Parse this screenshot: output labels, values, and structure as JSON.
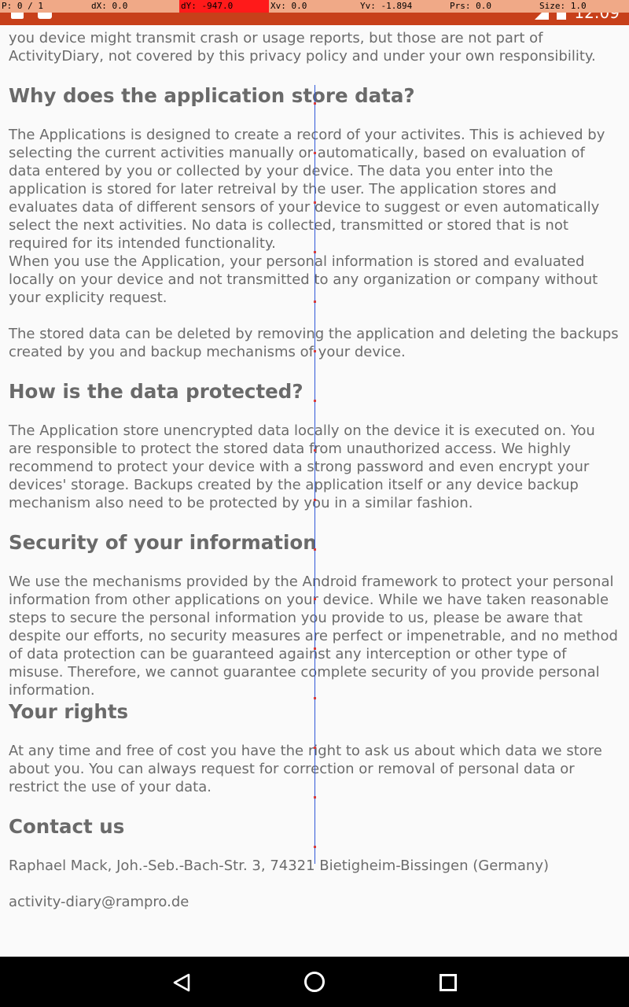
{
  "pointer_overlay": {
    "p": "P: 0 / 1",
    "dx": "dX: 0.0",
    "dy": "dY: -947.0",
    "xv": "Xv: 0.0",
    "yv": "Yv: -1.894",
    "prs": "Prs: 0.0",
    "size": "Size: 1.0"
  },
  "status_bar": {
    "time": "12:09"
  },
  "document": {
    "intro_tail": "you device might transmit crash or usage reports, but those are not part of ActivityDiary, not covered by this privacy policy and under your own responsibility.",
    "sections": [
      {
        "heading": "Why does the application store data?",
        "paragraphs": [
          "The Applications is designed to create a record of your activites. This is achieved by selecting the current activities manually or automatically, based on evaluation of data entered by you or collected by your device. The data you enter into the application is stored for later retreival by the user. The application stores and evaluates data of different sensors of your device to suggest or even automatically select the next activities. No data is collected, transmitted or stored that is not required for its intended functionality.",
          "When you use the Application, your personal information is stored and evaluated locally on your device and not transmitted to any organization or company without your explicity request.",
          "The stored data can be deleted by removing the application and deleting the backups created by you and backup mechanisms of your device."
        ]
      },
      {
        "heading": "How is the data protected?",
        "paragraphs": [
          "The Application store unencrypted data locally on the device it is executed on. You are responsible to protect the stored data from unauthorized access. We highly recommend to protect your device with a strong password and even encrypt your devices' storage. Backups created by the application itself or any device backup mechanism also need to be protected by you in a similar fashion."
        ]
      },
      {
        "heading": "Security of your information",
        "paragraphs": [
          "We use the mechanisms provided by the Android framework to protect your personal information from other applications on your device. While we have taken reasonable steps to secure the personal information you provide to us, please be aware that despite our efforts, no security measures are perfect or impenetrable, and no method of data protection can be guaranteed against any interception or other type of misuse. Therefore, we cannot guarantee complete security of you provide personal information."
        ]
      },
      {
        "heading": "Your rights",
        "paragraphs": [
          "At any time and free of cost you have the right to ask us about which data we store about you. You can always request for correction or removal of personal data or restrict the use of your data."
        ]
      },
      {
        "heading": "Contact us",
        "paragraphs": [
          "Raphael Mack, Joh.-Seb.-Bach-Str. 3, 74321 Bietigheim-Bissingen (Germany)",
          "activity-diary@rampro.de"
        ]
      }
    ]
  },
  "nav_bar": {
    "back_icon": "back-triangle-icon",
    "home_icon": "home-circle-icon",
    "recents_icon": "recents-square-icon"
  }
}
